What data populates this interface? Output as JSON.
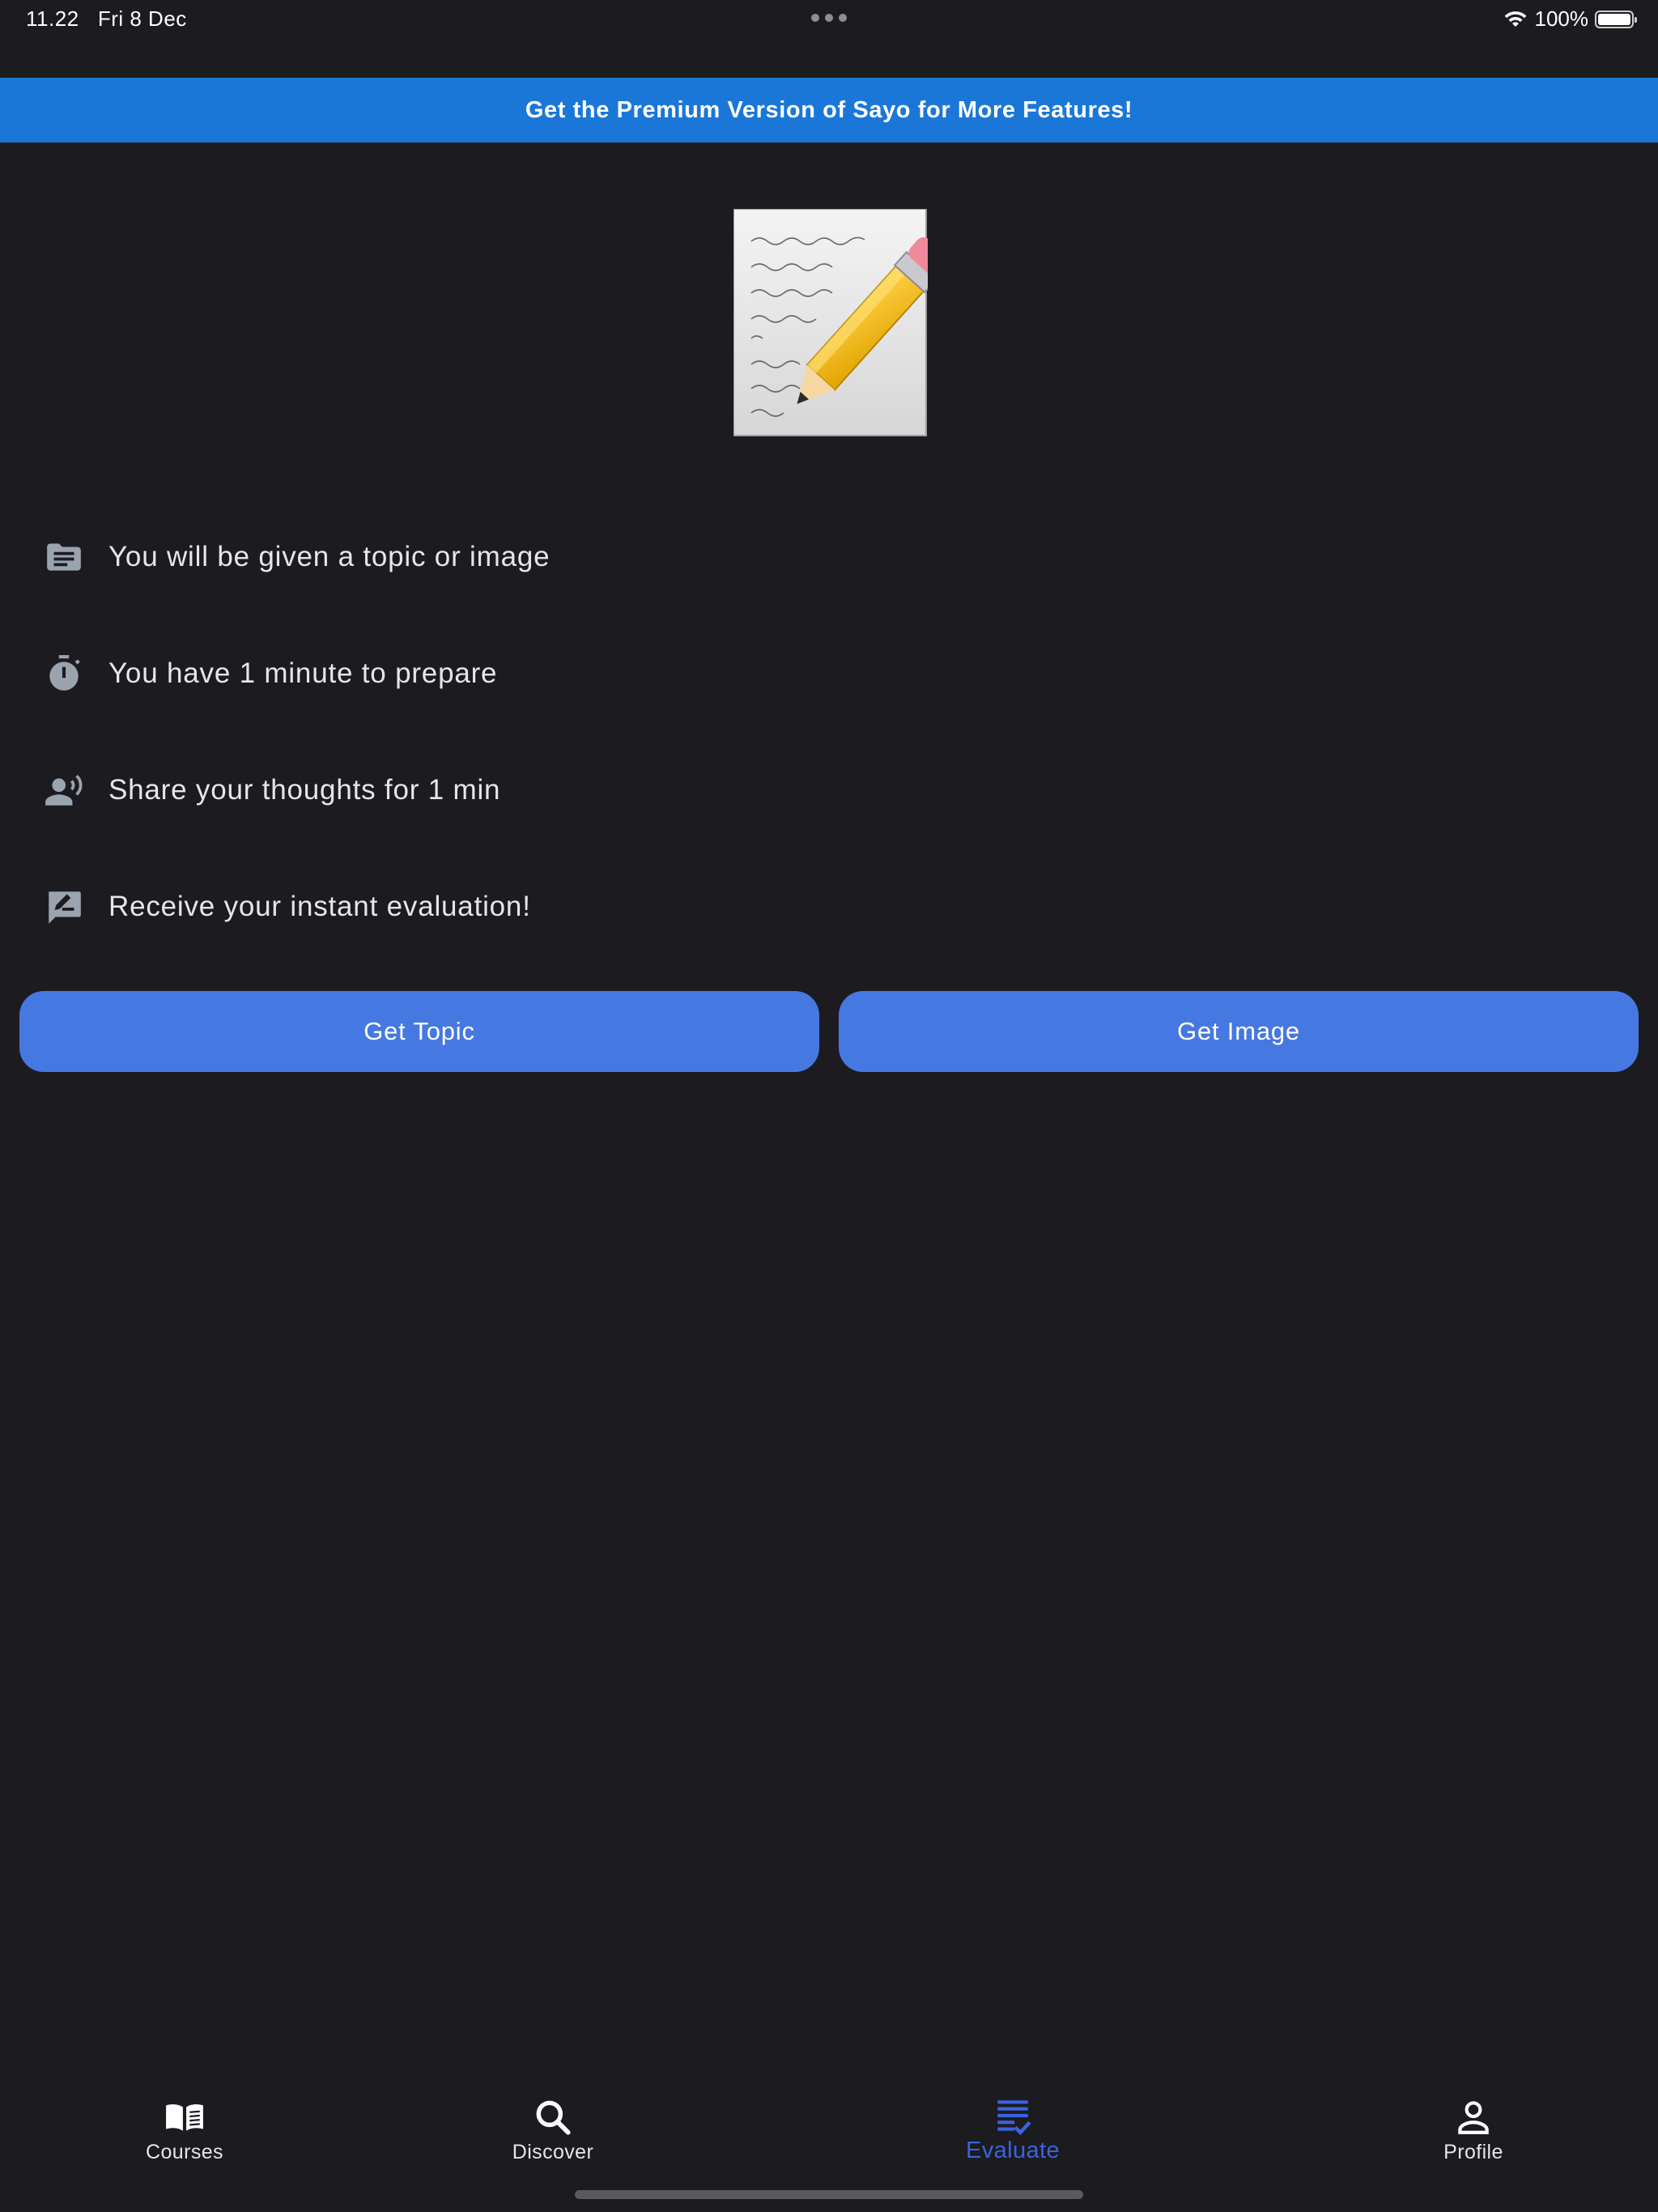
{
  "status_bar": {
    "time": "11.22",
    "date": "Fri 8 Dec",
    "battery": "100%",
    "battery_level": 1.0
  },
  "banner": {
    "text": "Get the Premium Version of Sayo for More Features!",
    "color": "#1a77d7"
  },
  "hero": {
    "icon": "memo-with-pencil-icon"
  },
  "steps": [
    {
      "icon": "topic-document-icon",
      "label": "You will be given a topic or image"
    },
    {
      "icon": "stopwatch-icon",
      "label": "You have 1 minute to prepare"
    },
    {
      "icon": "speaking-person-icon",
      "label": "Share your thoughts for 1 min"
    },
    {
      "icon": "rate-review-icon",
      "label": "Receive your instant evaluation!"
    }
  ],
  "buttons": {
    "get_topic": "Get Topic",
    "get_image": "Get Image",
    "color": "#4678e1"
  },
  "tabbar": {
    "active": "Evaluate",
    "active_color": "#3a63dc",
    "items": [
      {
        "label": "Courses",
        "icon": "open-book-icon"
      },
      {
        "label": "Discover",
        "icon": "search-icon"
      },
      {
        "label": "Evaluate",
        "icon": "checklist-icon"
      },
      {
        "label": "Profile",
        "icon": "person-icon"
      }
    ]
  }
}
